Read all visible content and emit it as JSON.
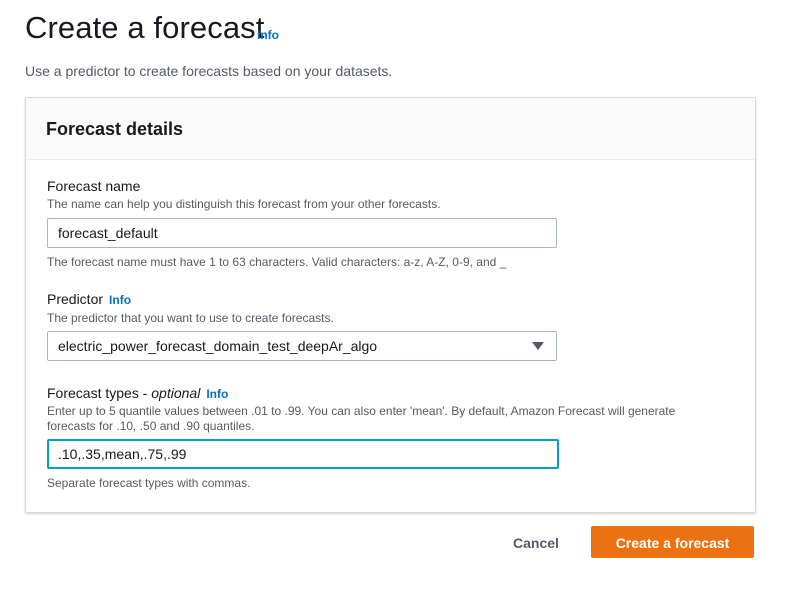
{
  "header": {
    "title": "Create a forecast",
    "info_label": "Info",
    "description": "Use a predictor to create forecasts based on your datasets."
  },
  "panel": {
    "title": "Forecast details"
  },
  "forecast_name": {
    "label": "Forecast name",
    "description": "The name can help you distinguish this forecast from your other forecasts.",
    "value": "forecast_default",
    "constraint": "The forecast name must have 1 to 63 characters. Valid characters: a-z, A-Z, 0-9, and _"
  },
  "predictor": {
    "label": "Predictor",
    "info_label": "Info",
    "description": "The predictor that you want to use to create forecasts.",
    "selected": "electric_power_forecast_domain_test_deepAr_algo",
    "icon": "caret-down-icon"
  },
  "forecast_types": {
    "label": "Forecast types - ",
    "optional_label": "optional",
    "info_label": "Info",
    "description": "Enter up to 5 quantile values between .01 to .99. You can also enter 'mean'. By default, Amazon Forecast will generate forecasts for .10, .50 and .90 quantiles.",
    "value": ".10,.35,mean,.75,.99",
    "hint": "Separate forecast types with commas."
  },
  "actions": {
    "cancel_label": "Cancel",
    "create_label": "Create a forecast"
  },
  "colors": {
    "accent": "#ec7211",
    "link": "#0073bb",
    "focus": "#00a1c9"
  }
}
